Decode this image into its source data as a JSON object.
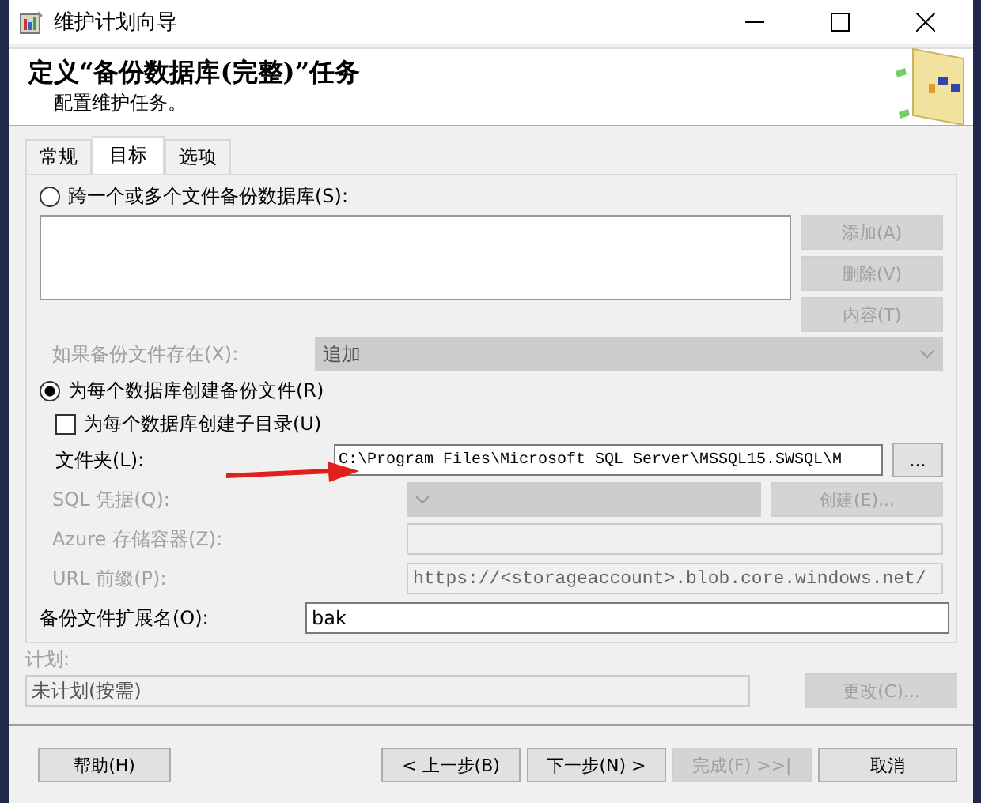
{
  "window": {
    "title": "维护计划向导"
  },
  "header": {
    "title": "定义“备份数据库(完整)”任务",
    "subtitle": "配置维护任务。"
  },
  "tabs": [
    {
      "label": "常规",
      "selected": false
    },
    {
      "label": "目标",
      "selected": true
    },
    {
      "label": "选项",
      "selected": false
    }
  ],
  "across_files": {
    "label": "跨一个或多个文件备份数据库(S):",
    "selected": false,
    "buttons": [
      {
        "label": "添加(A)",
        "disabled": true
      },
      {
        "label": "删除(V)",
        "disabled": true
      },
      {
        "label": "内容(T)",
        "disabled": true
      }
    ]
  },
  "if_exists": {
    "label": "如果备份文件存在(X):",
    "value": "追加",
    "disabled": true
  },
  "per_database": {
    "label": "为每个数据库创建备份文件(R)",
    "selected": true
  },
  "subdirectory": {
    "label": "为每个数据库创建子目录(U)",
    "checked": false
  },
  "folder": {
    "label": "文件夹(L):",
    "value": "C:\\Program Files\\Microsoft SQL Server\\MSSQL15.SWSQL\\M",
    "browse": "..."
  },
  "sql_credential": {
    "label": "SQL 凭据(Q):",
    "button": "创建(E)...",
    "disabled": true
  },
  "azure_container": {
    "label": "Azure 存储容器(Z):",
    "disabled": true
  },
  "url_prefix": {
    "label": "URL 前缀(P):",
    "value": "https://<storageaccount>.blob.core.windows.net/",
    "disabled": true
  },
  "extension": {
    "label": "备份文件扩展名(O):",
    "value": "bak"
  },
  "schedule": {
    "label": "计划:",
    "value": "未计划(按需)",
    "button": "更改(C)..."
  },
  "footer": [
    {
      "label": "帮助(H)",
      "disabled": false
    },
    {
      "label": "< 上一步(B)",
      "disabled": false
    },
    {
      "label": "下一步(N) >",
      "disabled": false
    },
    {
      "label": "完成(F) >>|",
      "disabled": true
    },
    {
      "label": "取消",
      "disabled": false
    }
  ]
}
